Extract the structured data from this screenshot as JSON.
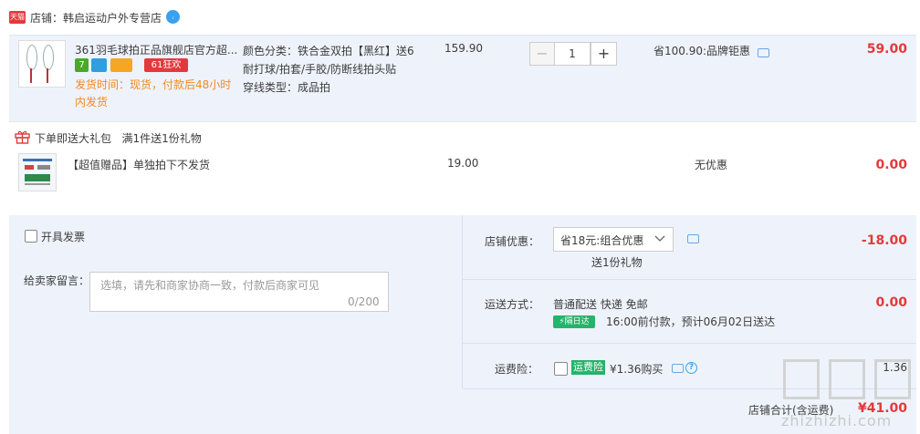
{
  "store": {
    "badge": "天猫",
    "label": "店铺：韩启运动户外专营店",
    "chat_icon": "chat-bubble-icon"
  },
  "item": {
    "title": "361羽毛球拍正品旗舰店官方超...",
    "tags": [
      {
        "text": "7",
        "color": "#4aa82a"
      },
      {
        "text": "",
        "color": "#2f9fe0"
      },
      {
        "text": "",
        "color": "#f5a623"
      },
      {
        "text": "61狂欢",
        "color": "#e4393c"
      }
    ],
    "ship_time": "发货时间：现货，付款后48小时内发货",
    "sku_lines": [
      "颜色分类：铁合金双拍【黑红】送6耐打球/拍套/手胶/防断线拍头贴",
      "穿线类型：成品拍"
    ],
    "price": "159.90",
    "quantity": "1",
    "minus": "−",
    "plus": "+",
    "saving": "省100.90:品牌钜惠",
    "subtotal": "59.00"
  },
  "gift": {
    "header": "下单即送大礼包",
    "rule": "满1件送1份礼物",
    "name": "【超值赠品】单独拍下不发货",
    "price": "19.00",
    "discount": "无优惠",
    "total": "0.00"
  },
  "order": {
    "invoice_label": "开具发票",
    "note_label": "给卖家留言：",
    "note_placeholder": "选填，请先和商家协商一致，付款后商家可见",
    "note_count": "0/200",
    "coupon_label": "店铺优惠：",
    "coupon_value": "省18元:组合优惠",
    "coupon_gift": "送1份礼物",
    "coupon_amount": "-18.00",
    "ship_label": "运送方式：",
    "ship_method": "普通配送 快递 免邮",
    "next_day": "隔日达",
    "ship_eta": "16:00前付款，预计06月02日送达",
    "ship_fee": "0.00",
    "insurance_label": "运费险：",
    "insurance_tag": "运费险",
    "insurance_price": "¥1.36购买",
    "insurance_amount": "1.36",
    "store_total_label": "店铺合计(含运费)",
    "store_total": "¥41.00"
  },
  "watermark": {
    "text": "zhizhizhi.com"
  },
  "colors": {
    "accent_red": "#e4393c",
    "panel_bg": "#eef3fb",
    "green": "#26b36b",
    "orange": "#f08a24"
  }
}
